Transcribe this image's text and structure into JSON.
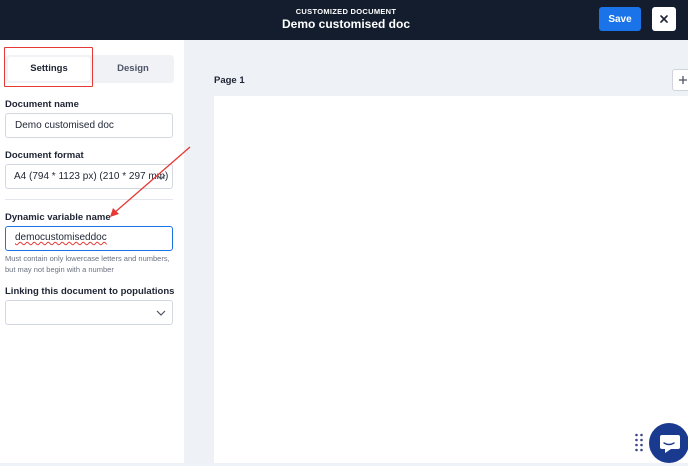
{
  "header": {
    "subtitle": "CUSTOMIZED DOCUMENT",
    "title": "Demo customised doc",
    "save_label": "Save",
    "close_icon": "close-icon"
  },
  "sidebar": {
    "tabs": [
      {
        "label": "Settings",
        "active": true
      },
      {
        "label": "Design",
        "active": false
      }
    ],
    "document_name": {
      "label": "Document name",
      "value": "Demo customised doc"
    },
    "document_format": {
      "label": "Document format",
      "value": "A4 (794 * 1123 px) (210 * 297 mm)"
    },
    "dynamic_variable": {
      "label": "Dynamic variable name",
      "value": "democustomiseddoc",
      "hint": "Must contain only lowercase letters and numbers, but may not begin with a number"
    },
    "linking": {
      "label": "Linking this document to populations",
      "value": ""
    }
  },
  "canvas": {
    "page_label": "Page 1",
    "add_icon": "plus-icon"
  },
  "colors": {
    "header_bg": "#141d2e",
    "accent": "#1a73e8",
    "annotation": "#e53935",
    "chat": "#1a3a8f"
  }
}
